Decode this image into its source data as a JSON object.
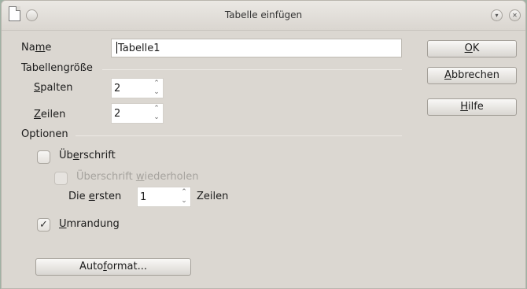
{
  "window": {
    "title": "Tabelle einfügen"
  },
  "name": {
    "label_before": "Na",
    "label_mnemonic": "m",
    "label_after": "e",
    "value": "Tabelle1"
  },
  "size": {
    "heading": "Tabellengröße",
    "columns": {
      "label_mnemonic": "S",
      "label_rest": "palten",
      "value": "2"
    },
    "rows": {
      "label_mnemonic": "Z",
      "label_rest": "eilen",
      "value": "2"
    }
  },
  "options": {
    "heading": "Optionen",
    "heading_row": {
      "before": "Üb",
      "mnemonic": "e",
      "after": "rschrift",
      "checked": false
    },
    "repeat_heading": {
      "before": "Überschrift ",
      "mnemonic": "w",
      "after": "iederholen",
      "checked": false,
      "enabled": false
    },
    "first_rows": {
      "before": "Die ",
      "mnemonic": "e",
      "after": "rsten",
      "value": "1",
      "suffix": "Zeilen"
    },
    "border": {
      "mnemonic": "U",
      "after": "mrandung",
      "checked": true,
      "check_glyph": "✓"
    }
  },
  "buttons": {
    "ok": {
      "mnemonic": "O",
      "after": "K"
    },
    "cancel": {
      "mnemonic": "A",
      "after": "bbrechen"
    },
    "help": {
      "mnemonic": "H",
      "after": "ilfe"
    },
    "autoformat": {
      "before": "Auto",
      "mnemonic": "f",
      "after": "ormat..."
    }
  },
  "spin_arrows": {
    "up": "⌃",
    "down": "⌄"
  }
}
